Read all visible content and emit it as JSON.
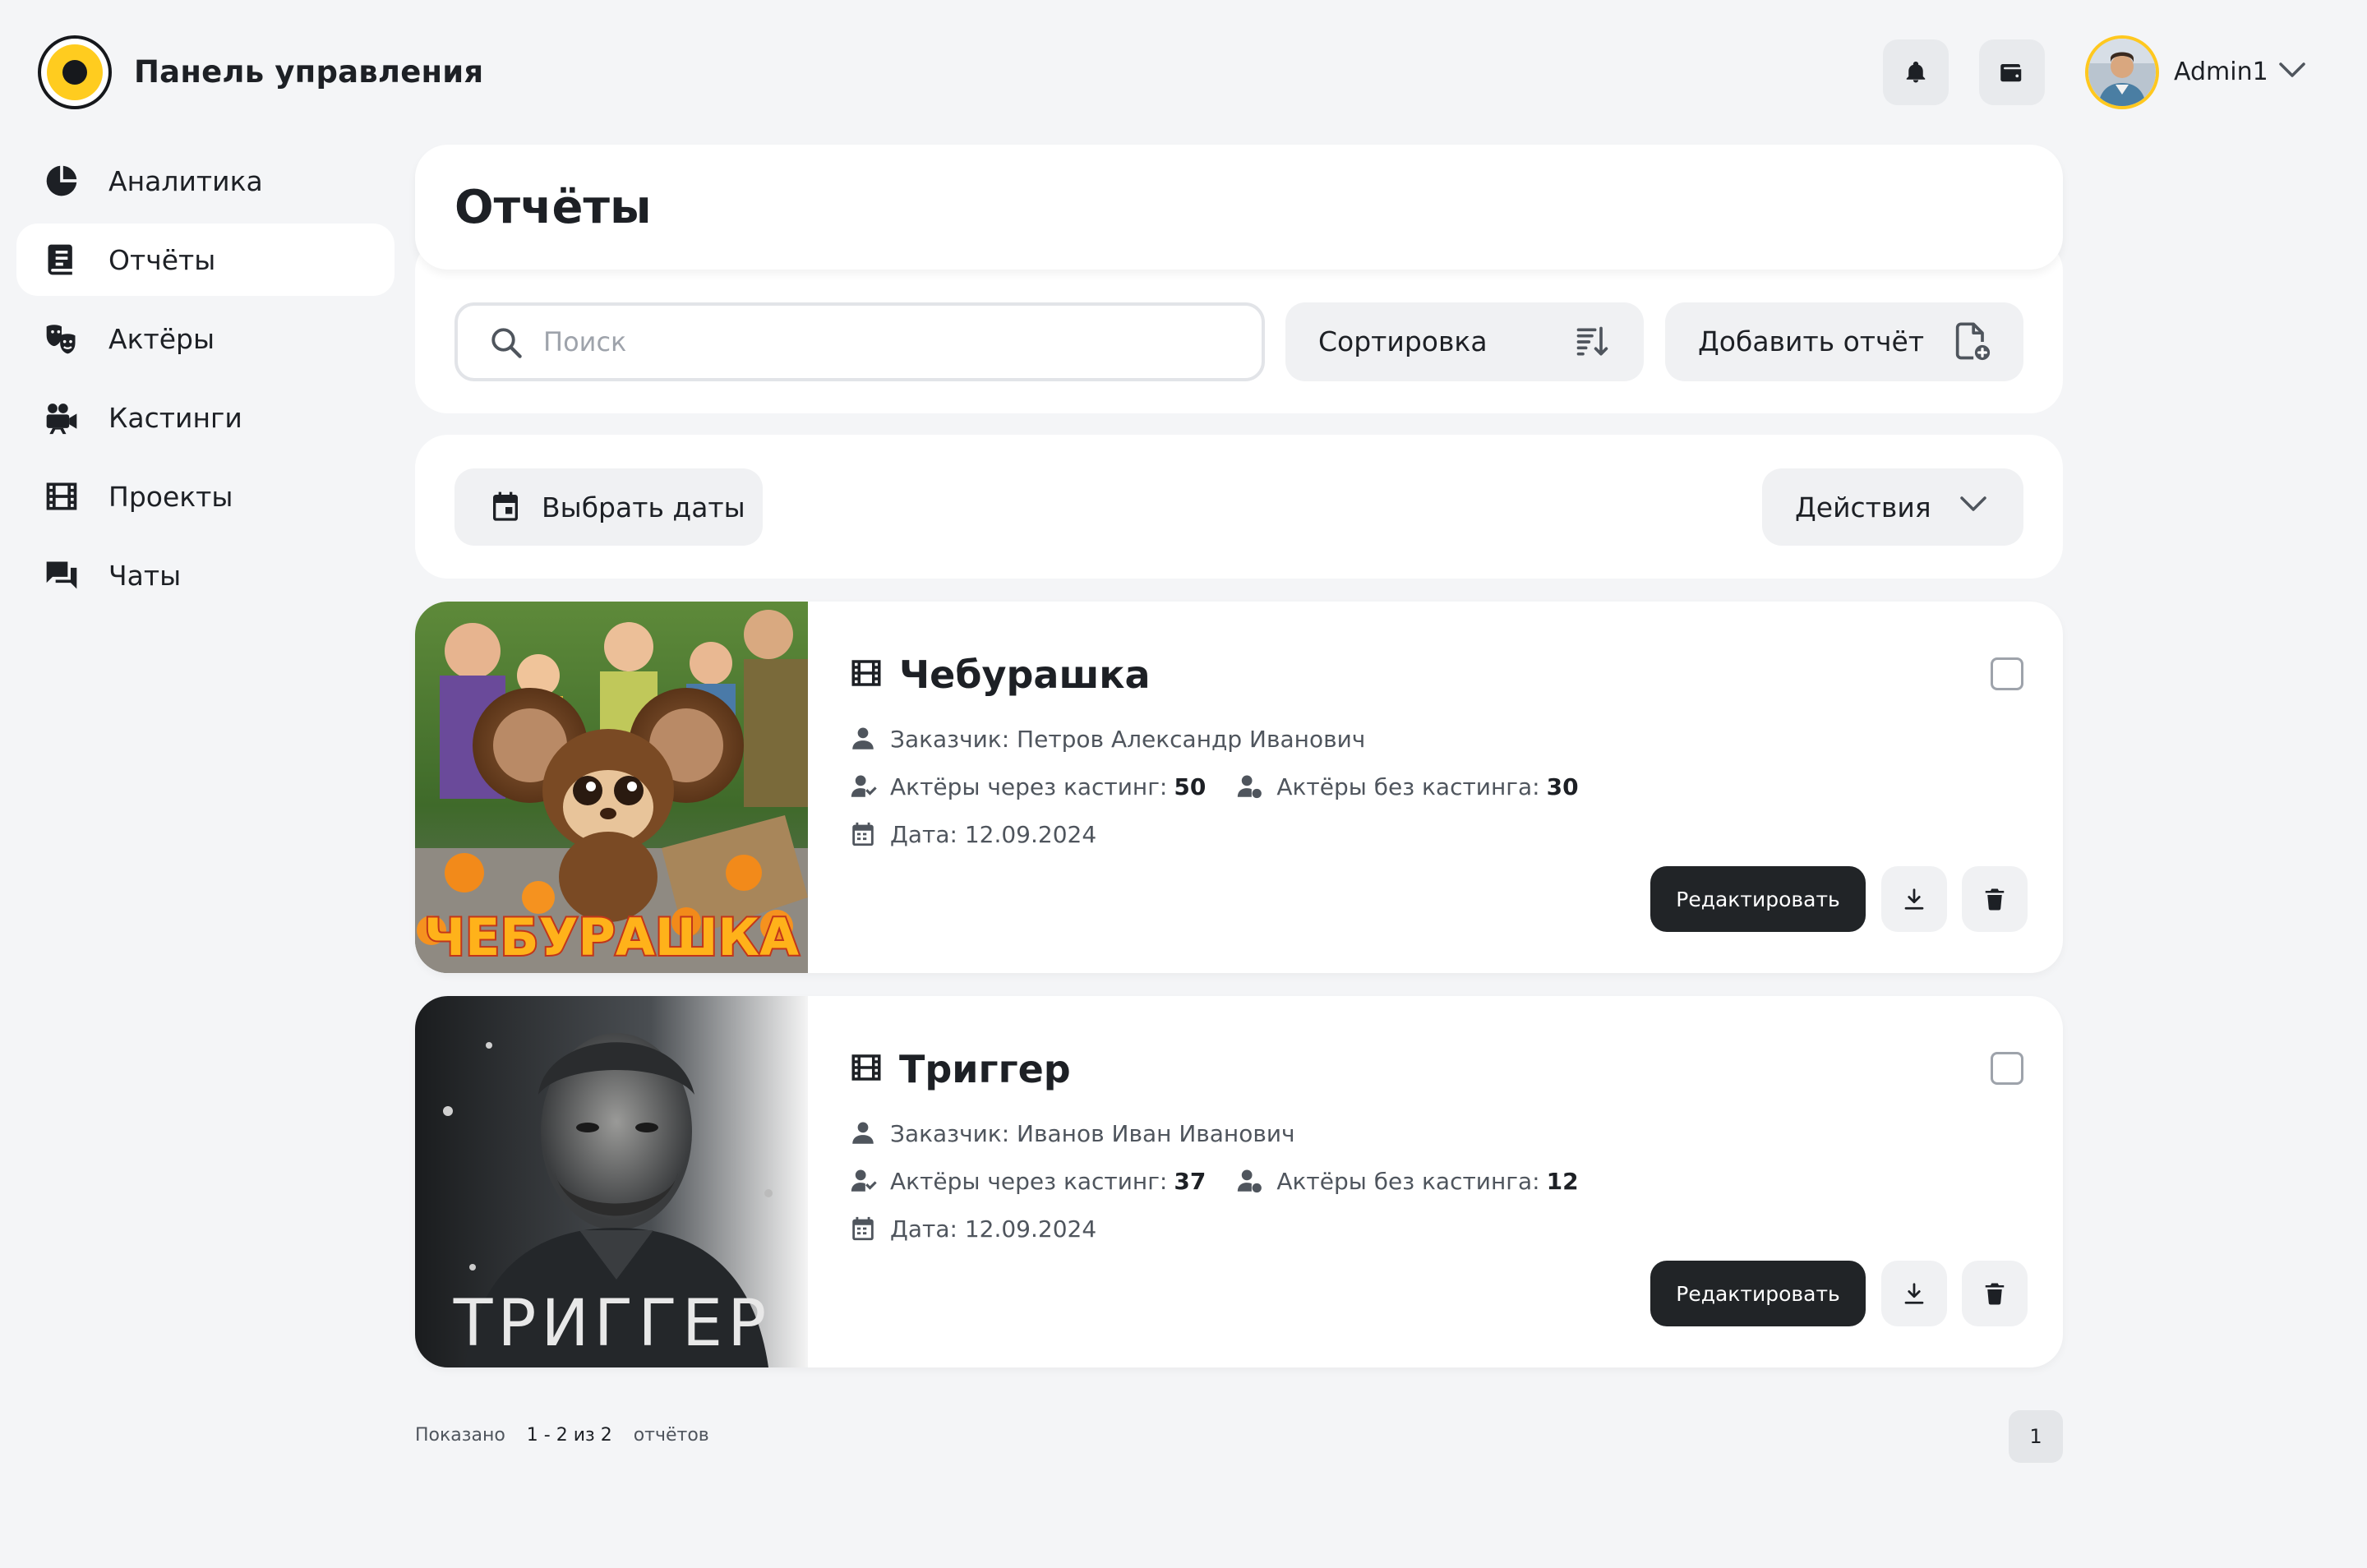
{
  "header": {
    "app_title": "Панель управления",
    "user_name": "Admin1",
    "icons": [
      "logo-icon",
      "bell-icon",
      "wallet-icon",
      "avatar",
      "chevron-down-icon"
    ]
  },
  "sidebar": {
    "items": [
      {
        "label": "Аналитика",
        "icon": "pie-chart-icon"
      },
      {
        "label": "Отчёты",
        "icon": "report-list-icon",
        "active": true
      },
      {
        "label": "Актёры",
        "icon": "theater-masks-icon"
      },
      {
        "label": "Кастинги",
        "icon": "movie-camera-icon"
      },
      {
        "label": "Проекты",
        "icon": "film-strip-icon"
      },
      {
        "label": "Чаты",
        "icon": "chat-bubbles-icon"
      }
    ]
  },
  "main": {
    "title": "Отчёты",
    "search": {
      "placeholder": "Поиск",
      "value": ""
    },
    "sort_label": "Сортировка",
    "add_report_label": "Добавить отчёт",
    "select_dates_label": "Выбрать даты",
    "actions_label": "Действия"
  },
  "reports": [
    {
      "title": "Чебурашка",
      "poster_text": "ЧЕБУРАШКА",
      "customer": "Заказчик: Петров Александр Иванович",
      "actors_casting_label": "Актёры через кастинг:",
      "actors_casting": "50",
      "actors_no_casting_label": "Актёры без кастинга:",
      "actors_no_casting": "30",
      "date": "Дата: 12.09.2024",
      "edit_label": "Редактировать",
      "checked": false
    },
    {
      "title": "Триггер",
      "poster_text": "ТРИГГЕР",
      "customer": "Заказчик: Иванов Иван Иванович",
      "actors_casting_label": "Актёры через кастинг:",
      "actors_casting": "37",
      "actors_no_casting_label": "Актёры без кастинга:",
      "actors_no_casting": "12",
      "date": "Дата: 12.09.2024",
      "edit_label": "Редактировать",
      "checked": false
    }
  ],
  "pagination": {
    "shown_label": "Показано",
    "range": "1 - 2 из 2",
    "unit": "отчётов",
    "current_page": "1"
  },
  "colors": {
    "background": "#f4f5f7",
    "card": "#ffffff",
    "accent_yellow": "#ffcc1f",
    "dark_button": "#212427"
  }
}
